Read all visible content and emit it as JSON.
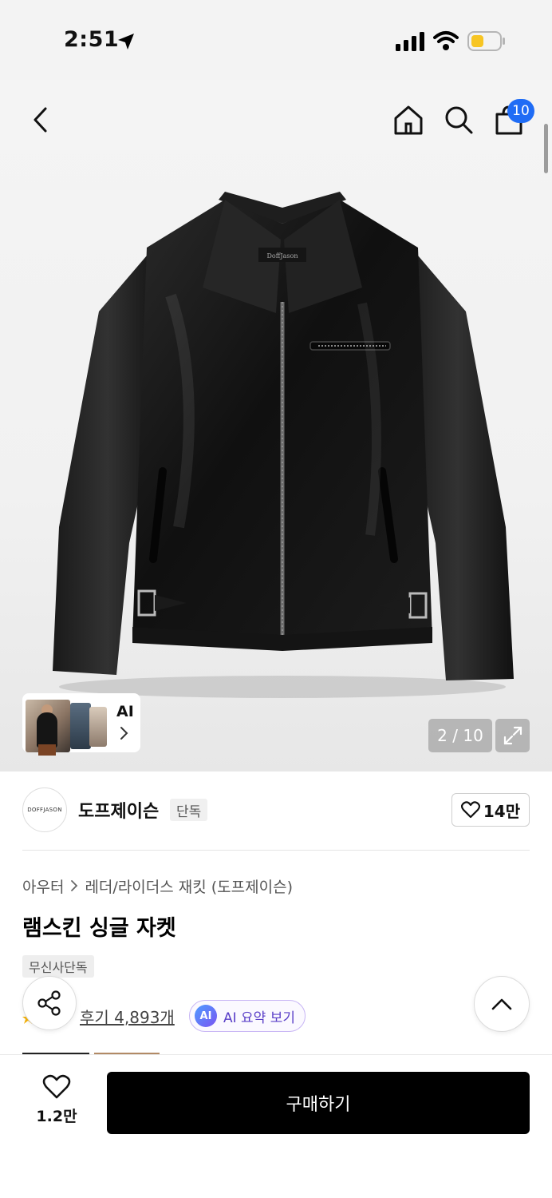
{
  "status_bar": {
    "time": "2:51"
  },
  "header": {
    "cart_count": "10"
  },
  "gallery": {
    "page_indicator": "2 / 10",
    "ai_card_label": "AI"
  },
  "brand": {
    "logo_text": "DOFFJASON",
    "name": "도프제이슨",
    "tag": "단독",
    "likes": "14만"
  },
  "product": {
    "breadcrumb": [
      "아우터",
      "레더/라이더스 재킷 (도프제이슨)"
    ],
    "title": "램스킨 싱글 자켓",
    "exclusive_badge": "무신사단독",
    "reviews": "후기 4,893개",
    "ai_summary_icon": "AI",
    "ai_summary_label": "AI 요약 보기"
  },
  "bottom_bar": {
    "wishlist_count": "1.2만",
    "buy_label": "구매하기"
  },
  "colors": {
    "accent": "#1f6cf5",
    "buy_button": "#000000",
    "ai_purple": "#5a3fc8"
  }
}
